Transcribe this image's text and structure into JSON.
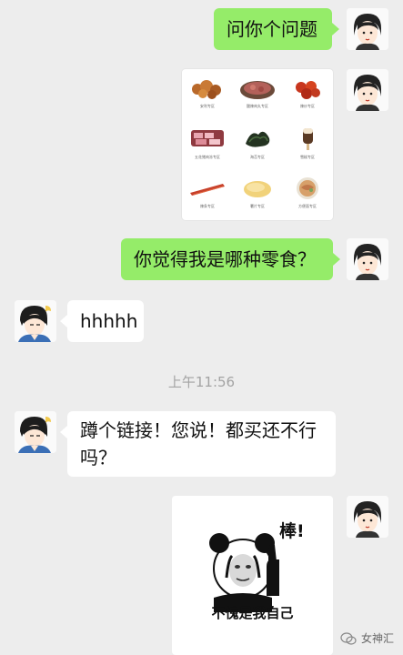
{
  "messages": {
    "m1": "问你个问题",
    "m3": "你觉得我是哪种零食？",
    "m4": "hhhhh",
    "time": "上午11:56",
    "m5": "蹲个链接！您说！都买还不行吗？"
  },
  "image_card": {
    "captions": [
      "安利专区",
      "酸辣肉丸专区",
      "辣炒专区",
      "五花猪肉冻专区",
      "海苔专区",
      "雪糕专区",
      "辣条专区",
      "薯片专区",
      "方便面专区"
    ]
  },
  "sticker": {
    "title": "棒!",
    "caption": "不愧是我自己"
  },
  "watermark": {
    "text": "女神汇"
  },
  "colors": {
    "background": "#ededed",
    "sent_bubble": "#95ec69",
    "received_bubble": "#ffffff"
  }
}
